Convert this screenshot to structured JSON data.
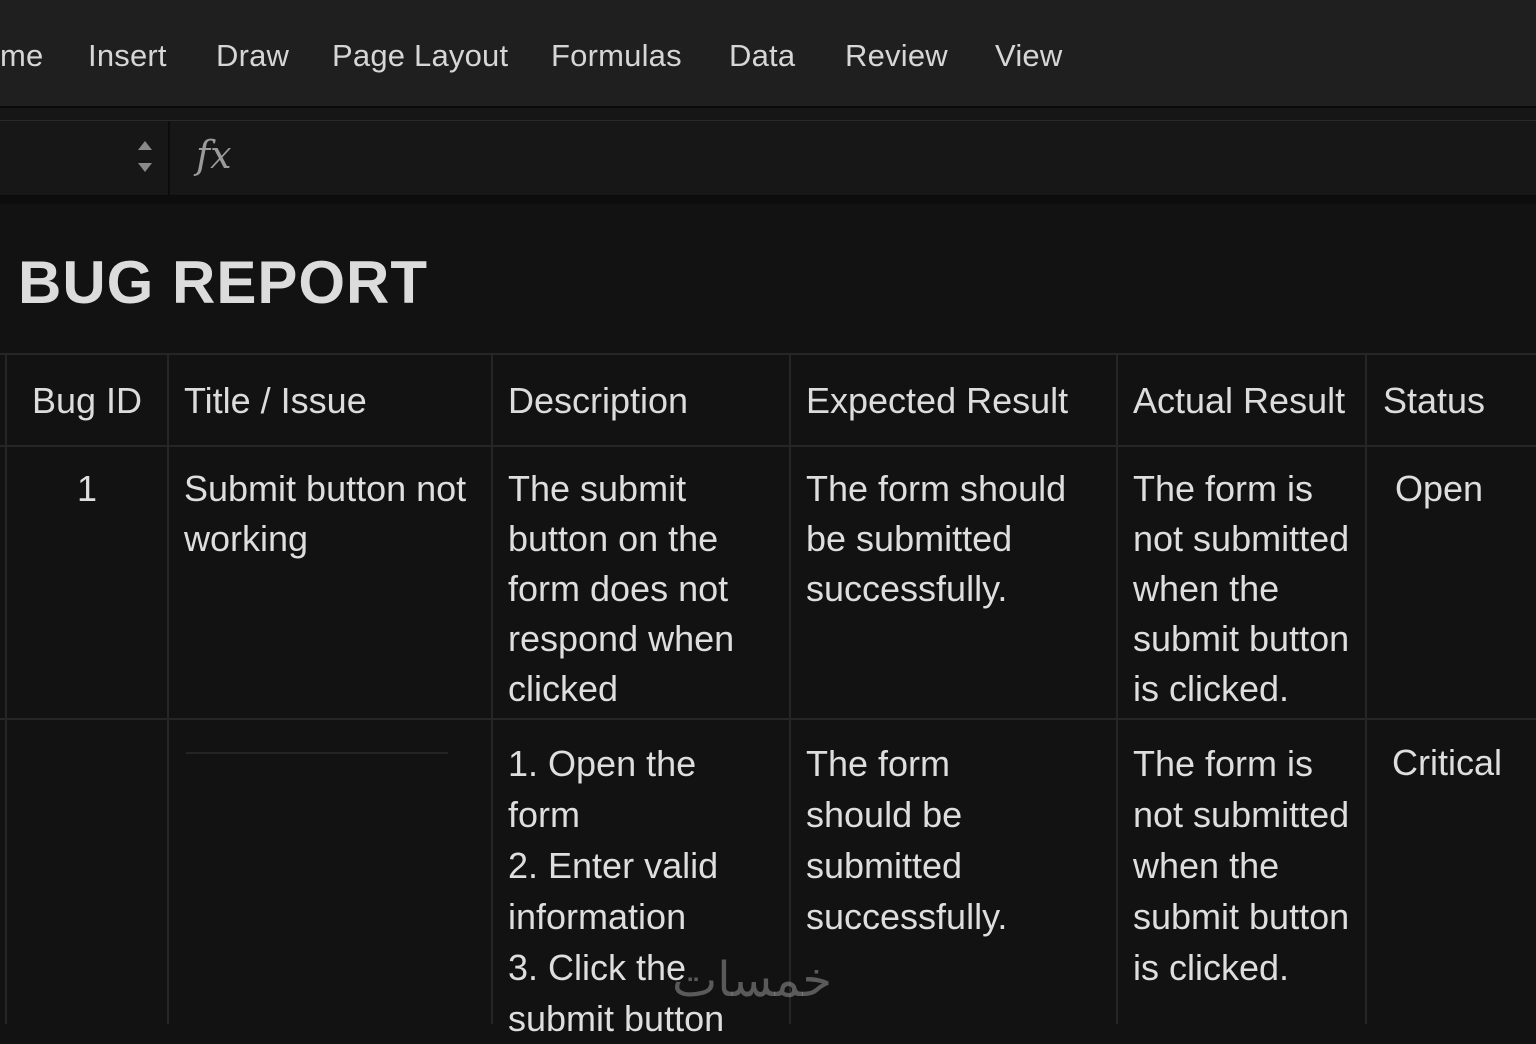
{
  "menu": {
    "items": [
      "me",
      "Insert",
      "Draw",
      "Page Layout",
      "Formulas",
      "Data",
      "Review",
      "View"
    ]
  },
  "formula_bar": {
    "fx_label": "fx",
    "value": ""
  },
  "sheet": {
    "title": "BUG REPORT",
    "columns": [
      "Bug ID",
      "Title / Issue",
      "Description",
      "Expected Result",
      "Actual Result",
      "Status"
    ],
    "rows": [
      {
        "bug_id": "1",
        "title": "Submit button not working",
        "description": [
          "The submit",
          "button on the",
          "form does not",
          "respond when",
          "clicked"
        ],
        "expected": [
          "The form should",
          "be submitted",
          "successfully."
        ],
        "actual": [
          "The form is",
          "not submitted",
          "when the",
          "submit button",
          "is clicked."
        ],
        "status": "Open"
      },
      {
        "bug_id": "",
        "title": "",
        "description": [
          "1. Open the",
          "form",
          "2. Enter valid",
          "information",
          "3. Click the",
          "submit button"
        ],
        "expected": [
          "The form",
          "should be",
          "submitted",
          "successfully."
        ],
        "actual": [
          "The form is",
          "not submitted",
          "when the",
          "submit button",
          "is clicked."
        ],
        "status": "Critical"
      }
    ]
  },
  "watermark": "خمسات"
}
